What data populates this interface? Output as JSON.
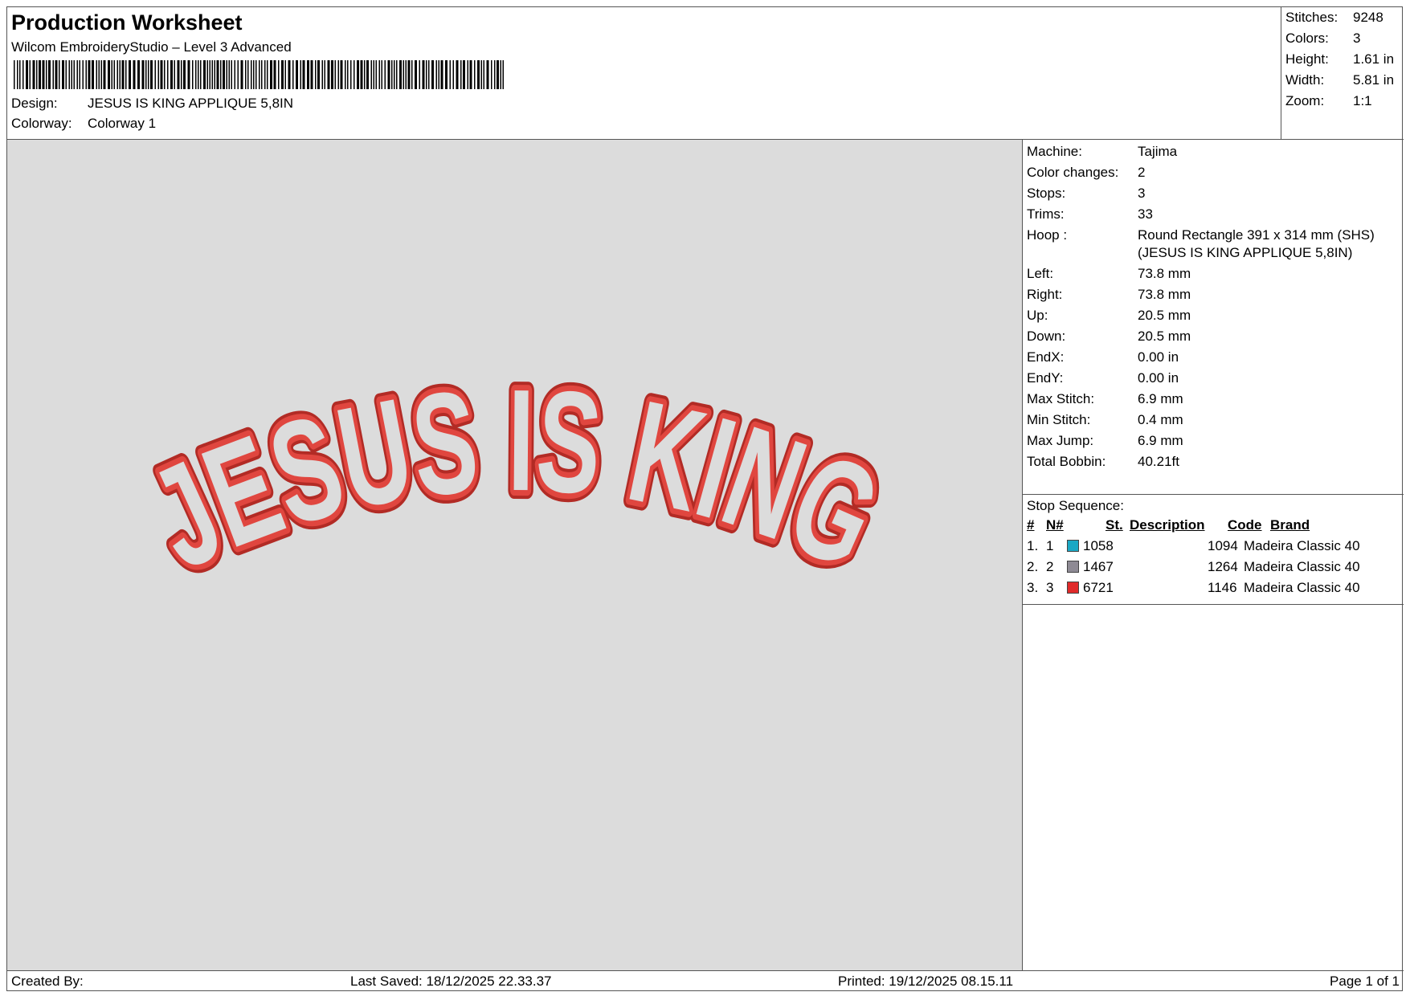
{
  "header": {
    "title": "Production Worksheet",
    "software": "Wilcom EmbroideryStudio – Level 3 Advanced",
    "design_label": "Design:",
    "design_value": "JESUS IS KING APPLIQUE 5,8IN",
    "colorway_label": "Colorway:",
    "colorway_value": "Colorway 1"
  },
  "stats": {
    "stitches_label": "Stitches:",
    "stitches": "9248",
    "colors_label": "Colors:",
    "colors": "3",
    "height_label": "Height:",
    "height": "1.61 in",
    "width_label": "Width:",
    "width": "5.81 in",
    "zoom_label": "Zoom:",
    "zoom": "1:1"
  },
  "preview": {
    "design_text": "JESUS IS KING",
    "thread_color": "#e0463f",
    "outline_color": "#b22b25",
    "background": "#dcdcdc"
  },
  "machine_info": [
    {
      "label": "Machine:",
      "value": "Tajima"
    },
    {
      "label": "Color changes:",
      "value": "2"
    },
    {
      "label": "Stops:",
      "value": "3"
    },
    {
      "label": "Trims:",
      "value": "33"
    },
    {
      "label": "Hoop :",
      "value": "Round Rectangle 391 x 314 mm (SHS) (JESUS IS KING APPLIQUE 5,8IN)"
    },
    {
      "label": "Left:",
      "value": "73.8 mm"
    },
    {
      "label": "Right:",
      "value": "73.8 mm"
    },
    {
      "label": "Up:",
      "value": "20.5 mm"
    },
    {
      "label": "Down:",
      "value": "20.5 mm"
    },
    {
      "label": "EndX:",
      "value": "0.00 in"
    },
    {
      "label": "EndY:",
      "value": "0.00 in"
    },
    {
      "label": "Max Stitch:",
      "value": "6.9 mm"
    },
    {
      "label": "Min Stitch:",
      "value": "0.4 mm"
    },
    {
      "label": "Max Jump:",
      "value": "6.9 mm"
    },
    {
      "label": "Total Bobbin:",
      "value": "40.21ft"
    }
  ],
  "stop_sequence": {
    "title": "Stop Sequence:",
    "headers": {
      "num": "#",
      "n": "N#",
      "st": "St.",
      "description": "Description",
      "code": "Code",
      "brand": "Brand"
    },
    "rows": [
      {
        "num": "1.",
        "n": "1",
        "color": "#1aa8c4",
        "st": "1058",
        "code": "1094",
        "brand": "Madeira Classic 40"
      },
      {
        "num": "2.",
        "n": "2",
        "color": "#8e8a94",
        "st": "1467",
        "code": "1264",
        "brand": "Madeira Classic 40"
      },
      {
        "num": "3.",
        "n": "3",
        "color": "#e02a2a",
        "st": "6721",
        "code": "1146",
        "brand": "Madeira Classic 40"
      }
    ]
  },
  "footer": {
    "created_by": "Created By:",
    "last_saved": "Last Saved: 18/12/2025 22.33.37",
    "printed": "Printed: 19/12/2025 08.15.11",
    "page": "Page 1 of 1"
  }
}
